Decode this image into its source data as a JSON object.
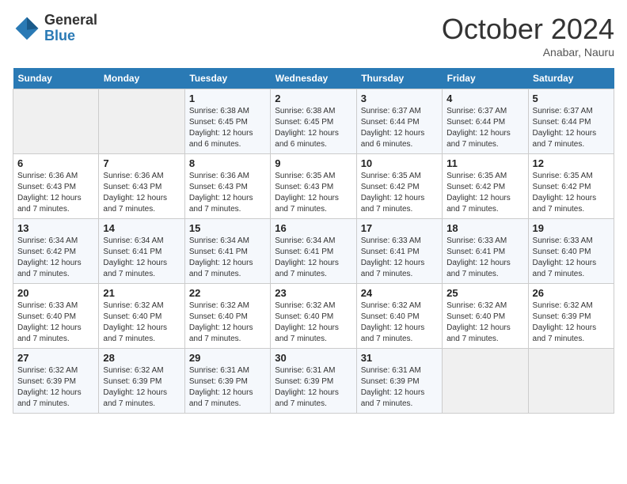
{
  "header": {
    "logo_general": "General",
    "logo_blue": "Blue",
    "month_title": "October 2024",
    "subtitle": "Anabar, Nauru"
  },
  "weekdays": [
    "Sunday",
    "Monday",
    "Tuesday",
    "Wednesday",
    "Thursday",
    "Friday",
    "Saturday"
  ],
  "rows": [
    [
      {
        "day": "",
        "info": ""
      },
      {
        "day": "",
        "info": ""
      },
      {
        "day": "1",
        "info": "Sunrise: 6:38 AM\nSunset: 6:45 PM\nDaylight: 12 hours and 6 minutes."
      },
      {
        "day": "2",
        "info": "Sunrise: 6:38 AM\nSunset: 6:45 PM\nDaylight: 12 hours and 6 minutes."
      },
      {
        "day": "3",
        "info": "Sunrise: 6:37 AM\nSunset: 6:44 PM\nDaylight: 12 hours and 6 minutes."
      },
      {
        "day": "4",
        "info": "Sunrise: 6:37 AM\nSunset: 6:44 PM\nDaylight: 12 hours and 7 minutes."
      },
      {
        "day": "5",
        "info": "Sunrise: 6:37 AM\nSunset: 6:44 PM\nDaylight: 12 hours and 7 minutes."
      }
    ],
    [
      {
        "day": "6",
        "info": "Sunrise: 6:36 AM\nSunset: 6:43 PM\nDaylight: 12 hours and 7 minutes."
      },
      {
        "day": "7",
        "info": "Sunrise: 6:36 AM\nSunset: 6:43 PM\nDaylight: 12 hours and 7 minutes."
      },
      {
        "day": "8",
        "info": "Sunrise: 6:36 AM\nSunset: 6:43 PM\nDaylight: 12 hours and 7 minutes."
      },
      {
        "day": "9",
        "info": "Sunrise: 6:35 AM\nSunset: 6:43 PM\nDaylight: 12 hours and 7 minutes."
      },
      {
        "day": "10",
        "info": "Sunrise: 6:35 AM\nSunset: 6:42 PM\nDaylight: 12 hours and 7 minutes."
      },
      {
        "day": "11",
        "info": "Sunrise: 6:35 AM\nSunset: 6:42 PM\nDaylight: 12 hours and 7 minutes."
      },
      {
        "day": "12",
        "info": "Sunrise: 6:35 AM\nSunset: 6:42 PM\nDaylight: 12 hours and 7 minutes."
      }
    ],
    [
      {
        "day": "13",
        "info": "Sunrise: 6:34 AM\nSunset: 6:42 PM\nDaylight: 12 hours and 7 minutes."
      },
      {
        "day": "14",
        "info": "Sunrise: 6:34 AM\nSunset: 6:41 PM\nDaylight: 12 hours and 7 minutes."
      },
      {
        "day": "15",
        "info": "Sunrise: 6:34 AM\nSunset: 6:41 PM\nDaylight: 12 hours and 7 minutes."
      },
      {
        "day": "16",
        "info": "Sunrise: 6:34 AM\nSunset: 6:41 PM\nDaylight: 12 hours and 7 minutes."
      },
      {
        "day": "17",
        "info": "Sunrise: 6:33 AM\nSunset: 6:41 PM\nDaylight: 12 hours and 7 minutes."
      },
      {
        "day": "18",
        "info": "Sunrise: 6:33 AM\nSunset: 6:41 PM\nDaylight: 12 hours and 7 minutes."
      },
      {
        "day": "19",
        "info": "Sunrise: 6:33 AM\nSunset: 6:40 PM\nDaylight: 12 hours and 7 minutes."
      }
    ],
    [
      {
        "day": "20",
        "info": "Sunrise: 6:33 AM\nSunset: 6:40 PM\nDaylight: 12 hours and 7 minutes."
      },
      {
        "day": "21",
        "info": "Sunrise: 6:32 AM\nSunset: 6:40 PM\nDaylight: 12 hours and 7 minutes."
      },
      {
        "day": "22",
        "info": "Sunrise: 6:32 AM\nSunset: 6:40 PM\nDaylight: 12 hours and 7 minutes."
      },
      {
        "day": "23",
        "info": "Sunrise: 6:32 AM\nSunset: 6:40 PM\nDaylight: 12 hours and 7 minutes."
      },
      {
        "day": "24",
        "info": "Sunrise: 6:32 AM\nSunset: 6:40 PM\nDaylight: 12 hours and 7 minutes."
      },
      {
        "day": "25",
        "info": "Sunrise: 6:32 AM\nSunset: 6:40 PM\nDaylight: 12 hours and 7 minutes."
      },
      {
        "day": "26",
        "info": "Sunrise: 6:32 AM\nSunset: 6:39 PM\nDaylight: 12 hours and 7 minutes."
      }
    ],
    [
      {
        "day": "27",
        "info": "Sunrise: 6:32 AM\nSunset: 6:39 PM\nDaylight: 12 hours and 7 minutes."
      },
      {
        "day": "28",
        "info": "Sunrise: 6:32 AM\nSunset: 6:39 PM\nDaylight: 12 hours and 7 minutes."
      },
      {
        "day": "29",
        "info": "Sunrise: 6:31 AM\nSunset: 6:39 PM\nDaylight: 12 hours and 7 minutes."
      },
      {
        "day": "30",
        "info": "Sunrise: 6:31 AM\nSunset: 6:39 PM\nDaylight: 12 hours and 7 minutes."
      },
      {
        "day": "31",
        "info": "Sunrise: 6:31 AM\nSunset: 6:39 PM\nDaylight: 12 hours and 7 minutes."
      },
      {
        "day": "",
        "info": ""
      },
      {
        "day": "",
        "info": ""
      }
    ]
  ]
}
